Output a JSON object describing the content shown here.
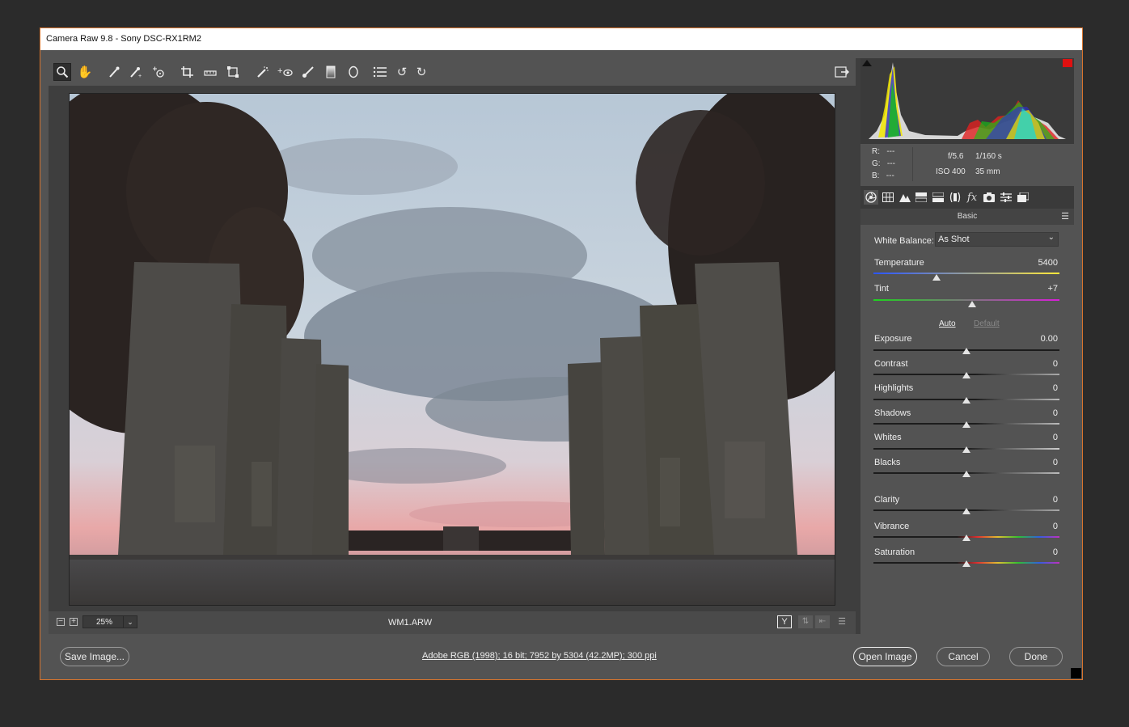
{
  "window": {
    "title": "Camera Raw 9.8  -  Sony DSC-RX1RM2"
  },
  "toolbar": {
    "tools": [
      "zoom-icon",
      "hand-icon",
      "white-balance-icon",
      "color-sampler-icon",
      "targeted-adjust-icon",
      "crop-icon",
      "straighten-icon",
      "transform-icon",
      "spot-removal-icon",
      "red-eye-icon",
      "adjustment-brush-icon",
      "graduated-filter-icon",
      "radial-filter-icon",
      "preferences-icon",
      "rotate-ccw-icon",
      "rotate-cw-icon"
    ],
    "fullscreen_icon": "fullscreen-toggle-icon"
  },
  "status": {
    "zoom": "25%",
    "filename": "WM1.ARW"
  },
  "info": {
    "r_label": "R:",
    "r_val": "---",
    "g_label": "G:",
    "g_val": "---",
    "b_label": "B:",
    "b_val": "---",
    "aperture": "f/5.6",
    "shutter": "1/160 s",
    "iso": "ISO 400",
    "focal": "35 mm"
  },
  "panel": {
    "title": "Basic",
    "white_balance_label": "White Balance:",
    "white_balance_value": "As Shot",
    "auto_label": "Auto",
    "default_label": "Default",
    "temperature": {
      "label": "Temperature",
      "value": "5400",
      "pos": 0.34
    },
    "tint": {
      "label": "Tint",
      "value": "+7",
      "pos": 0.53
    },
    "exposure": {
      "label": "Exposure",
      "value": "0.00",
      "pos": 0.5
    },
    "contrast": {
      "label": "Contrast",
      "value": "0",
      "pos": 0.5
    },
    "highlights": {
      "label": "Highlights",
      "value": "0",
      "pos": 0.5
    },
    "shadows": {
      "label": "Shadows",
      "value": "0",
      "pos": 0.5
    },
    "whites": {
      "label": "Whites",
      "value": "0",
      "pos": 0.5
    },
    "blacks": {
      "label": "Blacks",
      "value": "0",
      "pos": 0.5
    },
    "clarity": {
      "label": "Clarity",
      "value": "0",
      "pos": 0.5
    },
    "vibrance": {
      "label": "Vibrance",
      "value": "0",
      "pos": 0.5
    },
    "saturation": {
      "label": "Saturation",
      "value": "0",
      "pos": 0.5
    }
  },
  "bottom": {
    "save_label": "Save Image...",
    "workflow_link": "Adobe RGB (1998); 16 bit; 7952 by 5304 (42.2MP); 300 ppi",
    "open_label": "Open Image",
    "cancel_label": "Cancel",
    "done_label": "Done"
  },
  "colors": {
    "accent_border": "#d8742d",
    "clip_warning": "#e01010"
  }
}
